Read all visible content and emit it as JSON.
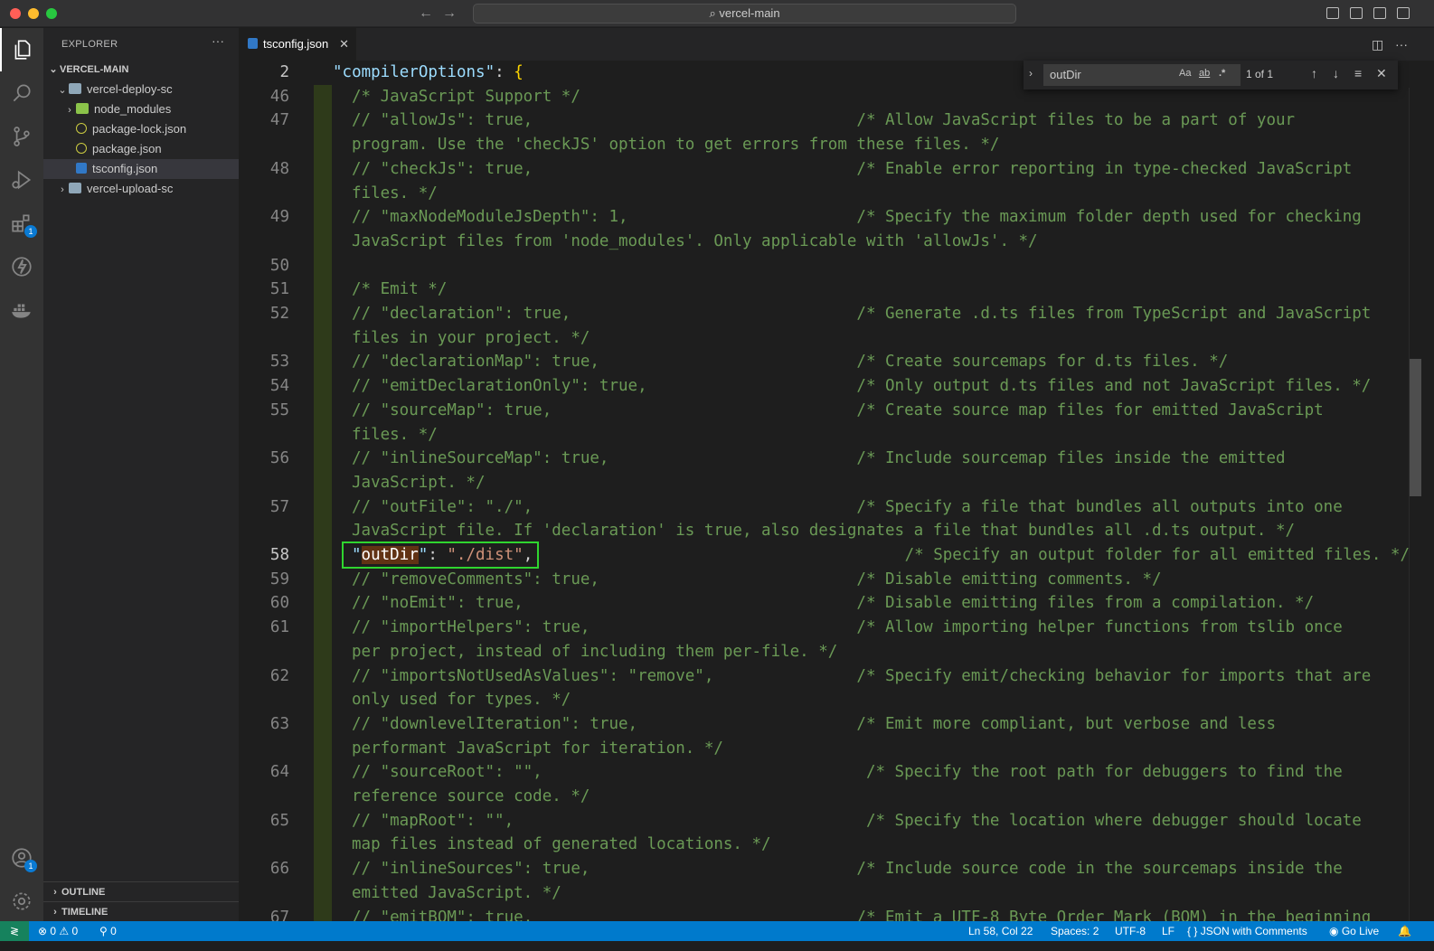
{
  "window": {
    "search_text": "vercel-main"
  },
  "sidebar": {
    "title": "EXPLORER",
    "more": "···",
    "root": "VERCEL-MAIN",
    "items": [
      {
        "label": "vercel-deploy-sc",
        "kind": "folder-open"
      },
      {
        "label": "node_modules",
        "kind": "folder-node"
      },
      {
        "label": "package-lock.json",
        "kind": "json"
      },
      {
        "label": "package.json",
        "kind": "json"
      },
      {
        "label": "tsconfig.json",
        "kind": "tsconfig"
      },
      {
        "label": "vercel-upload-sc",
        "kind": "folder"
      }
    ],
    "outline": "OUTLINE",
    "timeline": "TIMELINE"
  },
  "activity": {
    "extensions_badge": "1",
    "accounts_badge": "1"
  },
  "tab": {
    "label": "tsconfig.json",
    "close": "✕"
  },
  "find": {
    "value": "outDir",
    "case": "Aa",
    "word": "ab",
    "regex": ".*",
    "count": "1 of 1"
  },
  "editor": {
    "sticky": {
      "line": "2",
      "text": "\"compilerOptions\": {"
    },
    "lines": [
      {
        "n": "46",
        "t": "/* JavaScript Support */"
      },
      {
        "n": "47",
        "t": "// \"allowJs\": true,                                  /* Allow JavaScript files to be a part of your"
      },
      {
        "n": "",
        "t": "program. Use the 'checkJS' option to get errors from these files. */"
      },
      {
        "n": "48",
        "t": "// \"checkJs\": true,                                  /* Enable error reporting in type-checked JavaScript"
      },
      {
        "n": "",
        "t": "files. */"
      },
      {
        "n": "49",
        "t": "// \"maxNodeModuleJsDepth\": 1,                        /* Specify the maximum folder depth used for checking"
      },
      {
        "n": "",
        "t": "JavaScript files from 'node_modules'. Only applicable with 'allowJs'. */"
      },
      {
        "n": "50",
        "t": ""
      },
      {
        "n": "51",
        "t": "/* Emit */"
      },
      {
        "n": "52",
        "t": "// \"declaration\": true,                              /* Generate .d.ts files from TypeScript and JavaScript"
      },
      {
        "n": "",
        "t": "files in your project. */"
      },
      {
        "n": "53",
        "t": "// \"declarationMap\": true,                           /* Create sourcemaps for d.ts files. */"
      },
      {
        "n": "54",
        "t": "// \"emitDeclarationOnly\": true,                      /* Only output d.ts files and not JavaScript files. */"
      },
      {
        "n": "55",
        "t": "// \"sourceMap\": true,                                /* Create source map files for emitted JavaScript"
      },
      {
        "n": "",
        "t": "files. */"
      },
      {
        "n": "56",
        "t": "// \"inlineSourceMap\": true,                          /* Include sourcemap files inside the emitted"
      },
      {
        "n": "",
        "t": "JavaScript. */"
      },
      {
        "n": "57",
        "t": "// \"outFile\": \"./\",                                  /* Specify a file that bundles all outputs into one"
      },
      {
        "n": "",
        "t": "JavaScript file. If 'declaration' is true, also designates a file that bundles all .d.ts output. */"
      },
      {
        "n": "58",
        "t": "ACTIVE"
      },
      {
        "n": "59",
        "t": "// \"removeComments\": true,                           /* Disable emitting comments. */"
      },
      {
        "n": "60",
        "t": "// \"noEmit\": true,                                   /* Disable emitting files from a compilation. */"
      },
      {
        "n": "61",
        "t": "// \"importHelpers\": true,                            /* Allow importing helper functions from tslib once"
      },
      {
        "n": "",
        "t": "per project, instead of including them per-file. */"
      },
      {
        "n": "62",
        "t": "// \"importsNotUsedAsValues\": \"remove\",               /* Specify emit/checking behavior for imports that are"
      },
      {
        "n": "",
        "t": "only used for types. */"
      },
      {
        "n": "63",
        "t": "// \"downlevelIteration\": true,                       /* Emit more compliant, but verbose and less"
      },
      {
        "n": "",
        "t": "performant JavaScript for iteration. */"
      },
      {
        "n": "64",
        "t": "// \"sourceRoot\": \"\",                                  /* Specify the root path for debuggers to find the"
      },
      {
        "n": "",
        "t": "reference source code. */"
      },
      {
        "n": "65",
        "t": "// \"mapRoot\": \"\",                                     /* Specify the location where debugger should locate"
      },
      {
        "n": "",
        "t": "map files instead of generated locations. */"
      },
      {
        "n": "66",
        "t": "// \"inlineSources\": true,                            /* Include source code in the sourcemaps inside the"
      },
      {
        "n": "",
        "t": "emitted JavaScript. */"
      },
      {
        "n": "67",
        "t": "// \"emitBOM\": true,                                  /* Emit a UTF-8 Byte Order Mark (BOM) in the beginning"
      }
    ],
    "active_line": {
      "key": "outDir",
      "value": "\"./dist\"",
      "comment": "/* Specify an output folder for all emitted files. */"
    }
  },
  "status": {
    "errors": "0",
    "warnings": "0",
    "ports": "0",
    "position": "Ln 58, Col 22",
    "spaces": "Spaces: 2",
    "encoding": "UTF-8",
    "eol": "LF",
    "language": "JSON with Comments",
    "golive": "Go Live"
  }
}
